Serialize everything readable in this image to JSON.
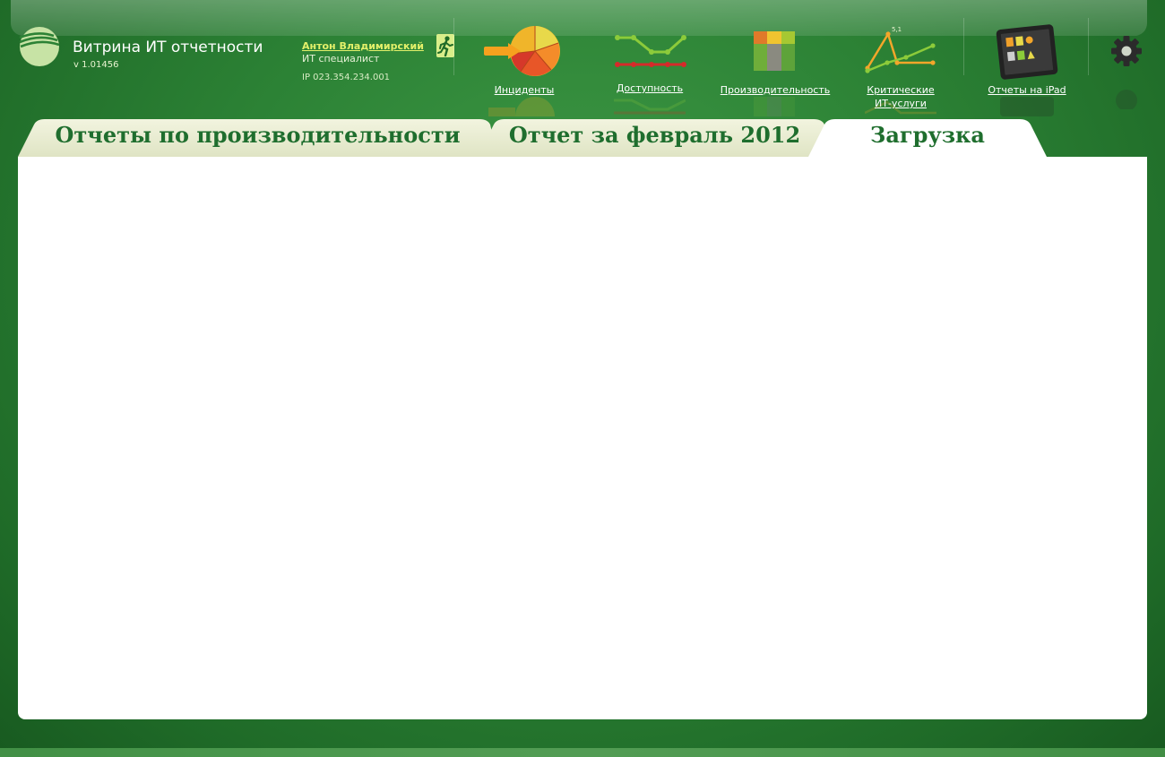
{
  "app": {
    "title": "Витрина ИТ отчетности",
    "version": "v 1.01456"
  },
  "user": {
    "name": "Антон Владимирский",
    "role": "ИТ специалист",
    "ip": "IP 023.354.234.001"
  },
  "nav": {
    "incidents_label": "Инциденты",
    "availability_label": "Доступность",
    "performance_label": "Производительность",
    "critical_label_line1": "Критические",
    "critical_label_line2": "ИТ-услуги",
    "critical_icon_value": "5,1",
    "ipad_label": "Отчеты на iPad"
  },
  "tabs": {
    "performance_reports": "Отчеты по производительности",
    "february_report": "Отчет за февраль 2012",
    "upload": "Загрузка",
    "active": "upload"
  },
  "icons": {
    "logo": "sberbank-logo-icon",
    "exit": "exit-icon",
    "settings": "gear-icon"
  },
  "colors": {
    "background": "#2c8235",
    "tab_text": "#1f6e2e",
    "user_link": "#e3f06a"
  }
}
